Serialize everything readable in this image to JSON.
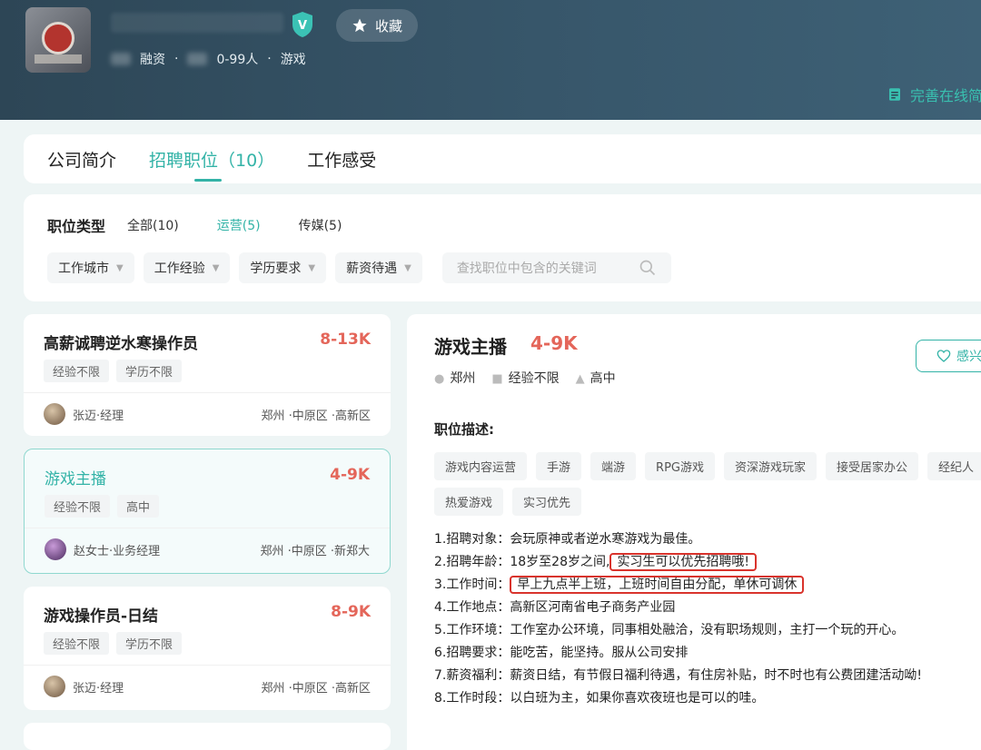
{
  "header": {
    "favorite_label": "收藏",
    "meta_investment": "融资",
    "meta_size": "0-99人",
    "meta_industry": "游戏",
    "meta_sep": "·",
    "resume_link": "完善在线简"
  },
  "tabs": [
    {
      "label": "公司简介"
    },
    {
      "label": "招聘职位（10）"
    },
    {
      "label": "工作感受"
    }
  ],
  "filters": {
    "type_label": "职位类型",
    "types": [
      {
        "label": "全部(10)"
      },
      {
        "label": "运营(5)"
      },
      {
        "label": "传媒(5)"
      }
    ],
    "dropdowns": [
      {
        "label": "工作城市"
      },
      {
        "label": "工作经验"
      },
      {
        "label": "学历要求"
      },
      {
        "label": "薪资待遇"
      }
    ],
    "search_placeholder": "查找职位中包含的关键词"
  },
  "jobs": [
    {
      "title": "高薪诚聘逆水寒操作员",
      "salary": "8-13K",
      "tags": [
        "经验不限",
        "学历不限"
      ],
      "recruiter": "张迈·经理",
      "location": "郑州 ·中原区 ·高新区",
      "avatar_color": "#8a6a4e"
    },
    {
      "title": "游戏主播",
      "salary": "4-9K",
      "tags": [
        "经验不限",
        "高中"
      ],
      "recruiter": "赵女士·业务经理",
      "location": "郑州 ·中原区 ·新郑大",
      "avatar_color": "#6a3b7a"
    },
    {
      "title": "游戏操作员-日结",
      "salary": "8-9K",
      "tags": [
        "经验不限",
        "学历不限"
      ],
      "recruiter": "张迈·经理",
      "location": "郑州 ·中原区 ·高新区",
      "avatar_color": "#8a6a4e"
    }
  ],
  "detail": {
    "title": "游戏主播",
    "salary": "4-9K",
    "interest_label": "感兴",
    "city": "郑州",
    "experience": "经验不限",
    "education": "高中",
    "desc_label": "职位描述:",
    "tags": [
      "游戏内容运营",
      "手游",
      "端游",
      "RPG游戏",
      "资深游戏玩家",
      "接受居家办公",
      "经纪人",
      "热爱游戏",
      "实习优先"
    ],
    "lines": [
      {
        "pre": "1.招聘对象：会玩原神或者逆水寒游戏为最佳。"
      },
      {
        "pre": "2.招聘年龄：18岁至28岁之间,",
        "hl": "实习生可以优先招聘哦!"
      },
      {
        "pre": "3.工作时间：",
        "hl": "早上九点半上班，上班时间自由分配，单休可调休"
      },
      {
        "pre": "4.工作地点：高新区河南省电子商务产业园"
      },
      {
        "pre": "5.工作环境：工作室办公环境，同事相处融洽，没有职场规则，主打一个玩的开心。"
      },
      {
        "pre": "6.招聘要求：能吃苦，能坚持。服从公司安排"
      },
      {
        "pre": "7.薪资福利：薪资日结，有节假日福利待遇，有住房补贴，时不时也有公费团建活动呦!"
      },
      {
        "pre": "8.工作时段：以白班为主，如果你喜欢夜班也是可以的哇。"
      }
    ]
  },
  "colors": {
    "accent": "#33b3a7",
    "salary": "#e4665a",
    "header_bg": "#37566a",
    "highlight_border": "#d9332c"
  }
}
